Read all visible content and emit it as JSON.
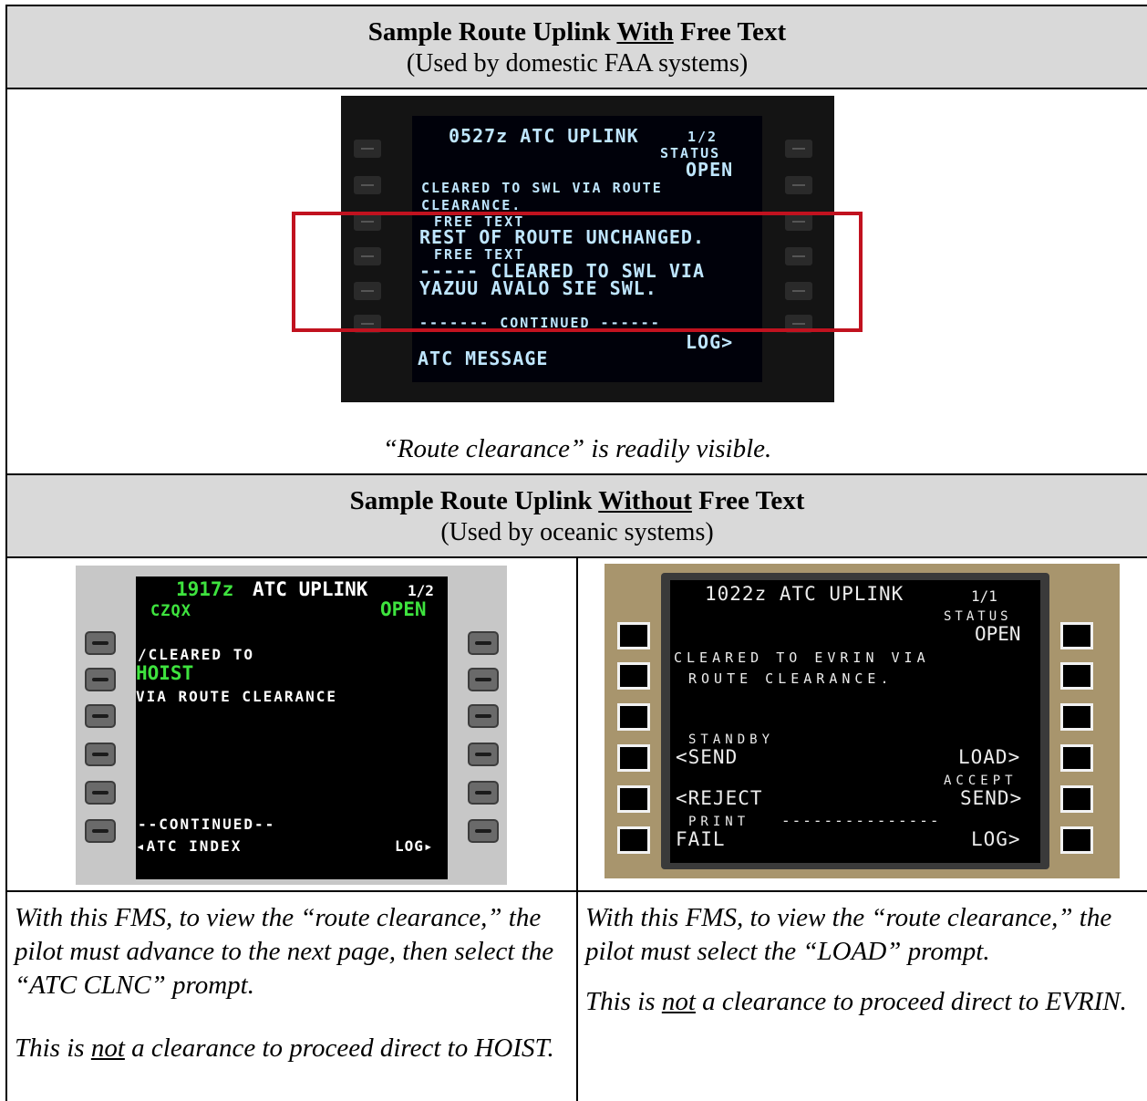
{
  "section1": {
    "title_prefix": "Sample Route Uplink ",
    "title_emph": "With",
    "title_suffix": " Free Text",
    "subtitle": "(Used by domestic FAA systems)",
    "caption": "“Route clearance” is readily visible."
  },
  "fms1": {
    "lines": {
      "header": "0527z ATC UPLINK",
      "page": "1/2",
      "status_label": "STATUS",
      "status_value": "OPEN",
      "l1": "CLEARED TO SWL VIA ROUTE",
      "l2": "CLEARANCE.",
      "free_text_1": "FREE TEXT",
      "l3": "REST OF ROUTE UNCHANGED.",
      "free_text_2": "FREE TEXT",
      "l4": "----- CLEARED TO SWL VIA",
      "l5": "YAZUU AVALO SIE SWL.",
      "continued": "------- CONTINUED ------",
      "log": "LOG>",
      "atc_message": "ATC MESSAGE"
    }
  },
  "section2": {
    "title_prefix": "Sample Route Uplink ",
    "title_emph": "Without",
    "title_suffix": " Free Text",
    "subtitle": "(Used by oceanic systems)"
  },
  "fms2": {
    "time": "1917z",
    "header": "ATC UPLINK",
    "page": "1/2",
    "facility": "CZQX",
    "status": "OPEN",
    "l1": "/CLEARED TO",
    "fix": "HOIST",
    "l2": "VIA ROUTE CLEARANCE",
    "continued": "--CONTINUED--",
    "atc_index": "◂ATC INDEX",
    "log": "LOG▸"
  },
  "fms3": {
    "header": "1022z ATC UPLINK",
    "page": "1/1",
    "status_label": "STATUS",
    "status_value": "OPEN",
    "l1": "CLEARED TO EVRIN VIA",
    "l2": "ROUTE CLEARANCE.",
    "standby": "STANDBY",
    "send": "<SEND",
    "load": "LOAD>",
    "accept": "ACCEPT",
    "reject": "<REJECT",
    "accept_send": "SEND>",
    "print": "PRINT",
    "dashes": "---------------",
    "fail": "FAIL",
    "log": "LOG>"
  },
  "left_cell": {
    "p1": "With this FMS, to view the “route clearance,” the pilot must advance to the next page, then select the “ATC CLNC” prompt.",
    "p2_before": "This is ",
    "p2_emph": "not",
    "p2_after": " a clearance to proceed direct to HOIST."
  },
  "right_cell": {
    "p1": "With this FMS, to view the “route clearance,” the pilot must select the “LOAD” prompt.",
    "p2_before": "This is ",
    "p2_emph": "not",
    "p2_after": " a clearance to proceed direct to EVRIN."
  }
}
